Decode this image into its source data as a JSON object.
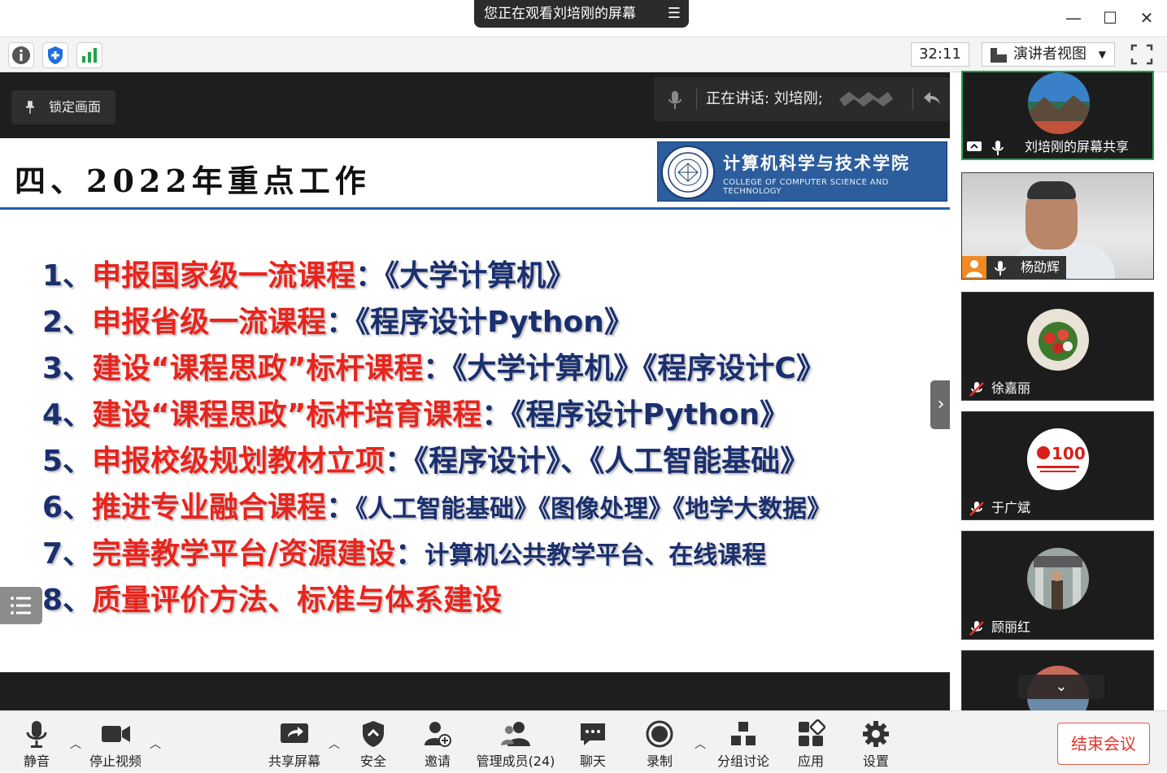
{
  "title_bar": {
    "share_notice": "您正在观看刘培刚的屏幕"
  },
  "toolbar": {
    "timer": "32:11",
    "view_mode": "演讲者视图"
  },
  "share": {
    "lock_label": "锁定画面",
    "speaking": "正在讲话: 刘培刚;"
  },
  "slide": {
    "title": "四、2022年重点工作",
    "college_cn": "计算机科学与技术学院",
    "college_en": "COLLEGE OF COMPUTER SCIENCE AND TECHNOLOGY",
    "items": [
      {
        "num": "1、",
        "head": "申报国家级一流课程",
        "colon": "：",
        "detail": "《大学计算机》"
      },
      {
        "num": "2、",
        "head": "申报省级一流课程",
        "colon": "：",
        "detail": "《程序设计Python》"
      },
      {
        "num": "3、",
        "head": "建设“课程思政”标杆课程",
        "colon": "：",
        "detail": "《大学计算机》《程序设计C》"
      },
      {
        "num": "4、",
        "head": "建设“课程思政”标杆培育课程",
        "colon": "：",
        "detail": "《程序设计Python》"
      },
      {
        "num": "5、",
        "head": "申报校级规划教材立项",
        "colon": "：",
        "detail": "《程序设计》、《人工智能基础》"
      },
      {
        "num": "6、",
        "head": "推进专业融合课程",
        "colon": "：",
        "detail": "《人工智能基础》《图像处理》《地学大数据》"
      },
      {
        "num": "7、",
        "head": "完善教学平台/资源建设",
        "colon": "：",
        "detail": "计算机公共教学平台、在线课程"
      },
      {
        "num": "8、",
        "head": "质量评价方法、标准与体系建设",
        "colon": "",
        "detail": ""
      }
    ]
  },
  "participants": [
    {
      "name": "刘培刚的屏幕共享"
    },
    {
      "name": "杨劭辉"
    },
    {
      "name": "徐嘉丽"
    },
    {
      "name": "于广斌"
    },
    {
      "name": "顾丽红"
    }
  ],
  "controls": {
    "mute": "静音",
    "stop_video": "停止视频",
    "share_screen": "共享屏幕",
    "security": "安全",
    "invite": "邀请",
    "manage_members": "管理成员(24)",
    "chat": "聊天",
    "record": "录制",
    "breakout": "分组讨论",
    "apps": "应用",
    "settings": "设置",
    "end_meeting": "结束会议"
  },
  "colors": {
    "accent_red": "#e8241c",
    "slide_navy": "#1a2f6e",
    "active_green": "#23a24a",
    "end_red": "#e0342a"
  }
}
